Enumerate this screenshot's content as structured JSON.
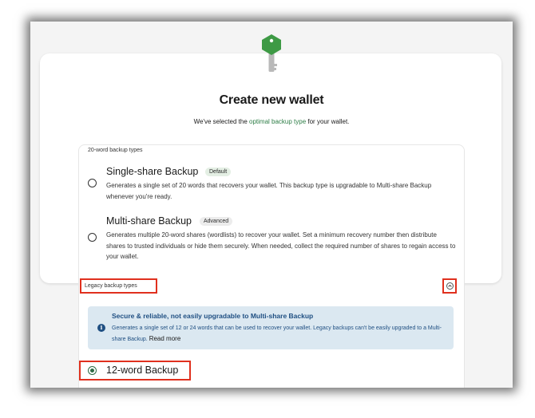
{
  "page": {
    "title": "Create new wallet",
    "subtitle_prefix": "We've selected the ",
    "subtitle_link": "optimal backup type",
    "subtitle_suffix": " for your wallet."
  },
  "sections": {
    "twenty_word_label": "20-word backup types",
    "legacy_label": "Legacy backup types"
  },
  "options": [
    {
      "title": "Single-share Backup",
      "badge": "Default",
      "description": "Generates a single set of 20 words that recovers your wallet. This backup type is upgradable to Multi-share Backup whenever you're ready.",
      "selected": false
    },
    {
      "title": "Multi-share Backup",
      "badge": "Advanced",
      "description": "Generates multiple 20-word shares (wordlists) to recover your wallet. Set a minimum recovery number then distribute shares to trusted individuals or hide them securely. When needed, collect the required number of shares to regain access to your wallet.",
      "selected": false
    },
    {
      "title": "12-word Backup",
      "selected": true
    }
  ],
  "info": {
    "title": "Secure & reliable, not easily upgradable to Multi-share Backup",
    "text": "Generates a single set of 12 or 24 words that can be used to recover your wallet. Legacy backups can't be easily upgraded to a Multi-share Backup. ",
    "read_more": "Read more"
  },
  "icons": {
    "key": "key-icon",
    "chevron": "chevron-up-icon",
    "info": "info-icon"
  },
  "colors": {
    "accent_green": "#2d7d46",
    "key_green": "#3e9a45",
    "info_bg": "#dbe8f1",
    "info_text": "#1f4f82",
    "highlight_red": "#e0301e"
  }
}
